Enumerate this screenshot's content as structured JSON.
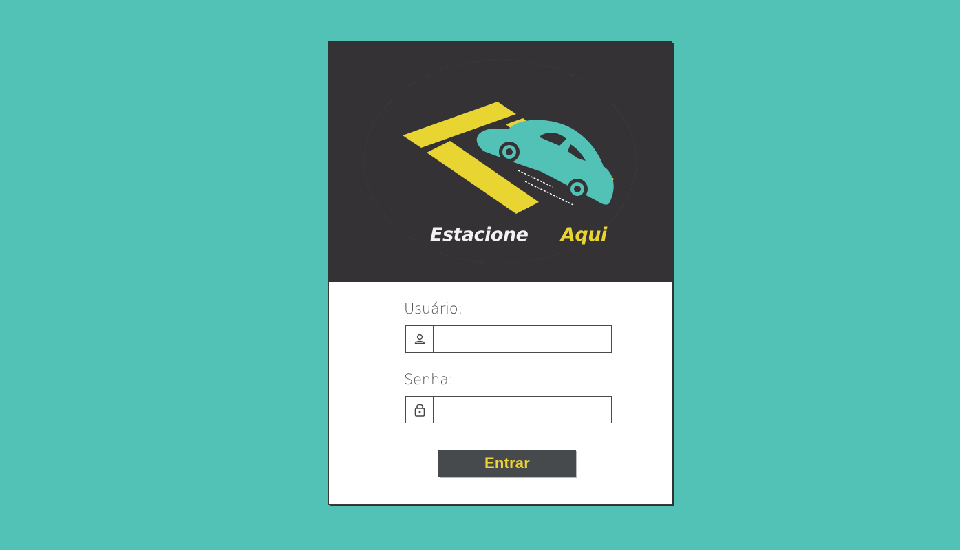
{
  "colors": {
    "background": "#52c1b6",
    "panel": "#343234",
    "brand_yellow": "#e8d532",
    "brand_teal": "#52c1b6",
    "button_bg": "#464a4c",
    "button_text": "#ecd33a"
  },
  "logo": {
    "word_primary": "Estacione",
    "word_accent": "Aqui",
    "icon": "car-parking-icon"
  },
  "form": {
    "username": {
      "label": "Usuário:",
      "value": "",
      "icon": "user-icon"
    },
    "password": {
      "label": "Senha:",
      "value": "",
      "icon": "lock-icon"
    },
    "submit_label": "Entrar"
  }
}
